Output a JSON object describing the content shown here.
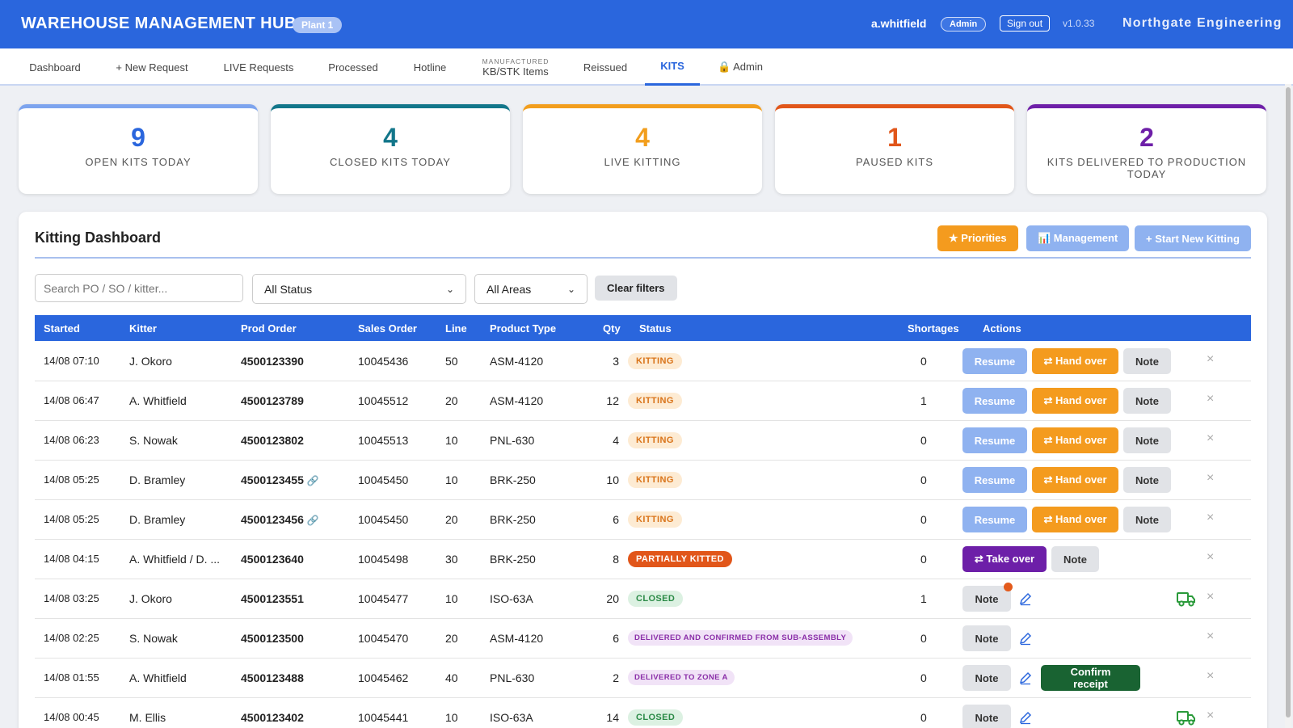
{
  "header": {
    "title": "WAREHOUSE MANAGEMENT HUB",
    "plant": "Plant 1",
    "user": "a.whitfield",
    "role": "Admin",
    "signout": "Sign out",
    "version": "v1.0.33",
    "company": "Northgate Engineering"
  },
  "nav": {
    "dashboard": "Dashboard",
    "new_request": "+ New Request",
    "live": "LIVE Requests",
    "processed": "Processed",
    "hotline": "Hotline",
    "kb_small": "MANUFACTURED",
    "kb": "KB/STK Items",
    "reissued": "Reissued",
    "kits": "KITS",
    "admin": "🔒 Admin"
  },
  "stats": [
    {
      "value": "9",
      "label": "OPEN KITS TODAY",
      "color": "#2a66dd"
    },
    {
      "value": "4",
      "label": "CLOSED KITS TODAY",
      "color": "#12768a"
    },
    {
      "value": "4",
      "label": "LIVE KITTING",
      "color": "#f29e1d"
    },
    {
      "value": "1",
      "label": "PAUSED KITS",
      "color": "#e1561a"
    },
    {
      "value": "2",
      "label": "KITS DELIVERED TO PRODUCTION TODAY",
      "color": "#6e1fa8"
    }
  ],
  "panel": {
    "title": "Kitting Dashboard",
    "priorities": "★ Priorities",
    "management": "📊 Management",
    "start": "+ Start New Kitting",
    "search_placeholder": "Search PO / SO / kitter...",
    "status_filter": "All Status",
    "area_filter": "All Areas",
    "clear": "Clear filters"
  },
  "table": {
    "columns": {
      "started": "Started",
      "kitter": "Kitter",
      "prod_order": "Prod Order",
      "sales_order": "Sales Order",
      "line": "Line",
      "product_type": "Product Type",
      "qty": "Qty",
      "status": "Status",
      "shortages": "Shortages",
      "actions": "Actions"
    },
    "labels": {
      "resume": "Resume",
      "handover": "⇄ Hand over",
      "note": "Note",
      "takeover": "⇄ Take over",
      "confirm": "Confirm receipt",
      "delete": "×",
      "link": "🔗"
    },
    "rows": [
      {
        "started": "14/08 07:10",
        "kitter": "J. Okoro",
        "po": "4500123390",
        "so": "10045436",
        "line": "50",
        "product": "ASM-4120",
        "qty": "3",
        "status": "KITTING",
        "shortages": "0"
      },
      {
        "started": "14/08 06:47",
        "kitter": "A. Whitfield",
        "po": "4500123789",
        "so": "10045512",
        "line": "20",
        "product": "ASM-4120",
        "qty": "12",
        "status": "KITTING",
        "shortages": "1"
      },
      {
        "started": "14/08 06:23",
        "kitter": "S. Nowak",
        "po": "4500123802",
        "so": "10045513",
        "line": "10",
        "product": "PNL-630",
        "qty": "4",
        "status": "KITTING",
        "shortages": "0"
      },
      {
        "started": "14/08 05:25",
        "kitter": "D. Bramley",
        "po": "4500123455",
        "so": "10045450",
        "line": "10",
        "product": "BRK-250",
        "qty": "10",
        "status": "KITTING",
        "shortages": "0"
      },
      {
        "started": "14/08 05:25",
        "kitter": "D. Bramley",
        "po": "4500123456",
        "so": "10045450",
        "line": "20",
        "product": "BRK-250",
        "qty": "6",
        "status": "KITTING",
        "shortages": "0"
      },
      {
        "started": "14/08 04:15",
        "kitter": "A. Whitfield / D. ...",
        "po": "4500123640",
        "so": "10045498",
        "line": "30",
        "product": "BRK-250",
        "qty": "8",
        "status": "PARTIALLY KITTED",
        "shortages": "0"
      },
      {
        "started": "14/08 03:25",
        "kitter": "J. Okoro",
        "po": "4500123551",
        "so": "10045477",
        "line": "10",
        "product": "ISO-63A",
        "qty": "20",
        "status": "CLOSED",
        "shortages": "1"
      },
      {
        "started": "14/08 02:25",
        "kitter": "S. Nowak",
        "po": "4500123500",
        "so": "10045470",
        "line": "20",
        "product": "ASM-4120",
        "qty": "6",
        "status": "DELIVERED AND CONFIRMED FROM SUB-ASSEMBLY",
        "shortages": "0"
      },
      {
        "started": "14/08 01:55",
        "kitter": "A. Whitfield",
        "po": "4500123488",
        "so": "10045462",
        "line": "40",
        "product": "PNL-630",
        "qty": "2",
        "status": "DELIVERED TO ZONE A",
        "shortages": "0"
      },
      {
        "started": "14/08 00:45",
        "kitter": "M. Ellis",
        "po": "4500123402",
        "so": "10045441",
        "line": "10",
        "product": "ISO-63A",
        "qty": "14",
        "status": "CLOSED",
        "shortages": "0"
      }
    ]
  },
  "colors": {
    "primary": "#2a66dd",
    "kitting_bg": "#fdebd3",
    "kitting_fg": "#d9741a",
    "partial_bg": "#e1561a",
    "closed_bg": "#dcf1e2",
    "closed_fg": "#2a8a46",
    "delivered_bg": "#f1e3f7",
    "delivered_fg": "#8a2ea8"
  }
}
